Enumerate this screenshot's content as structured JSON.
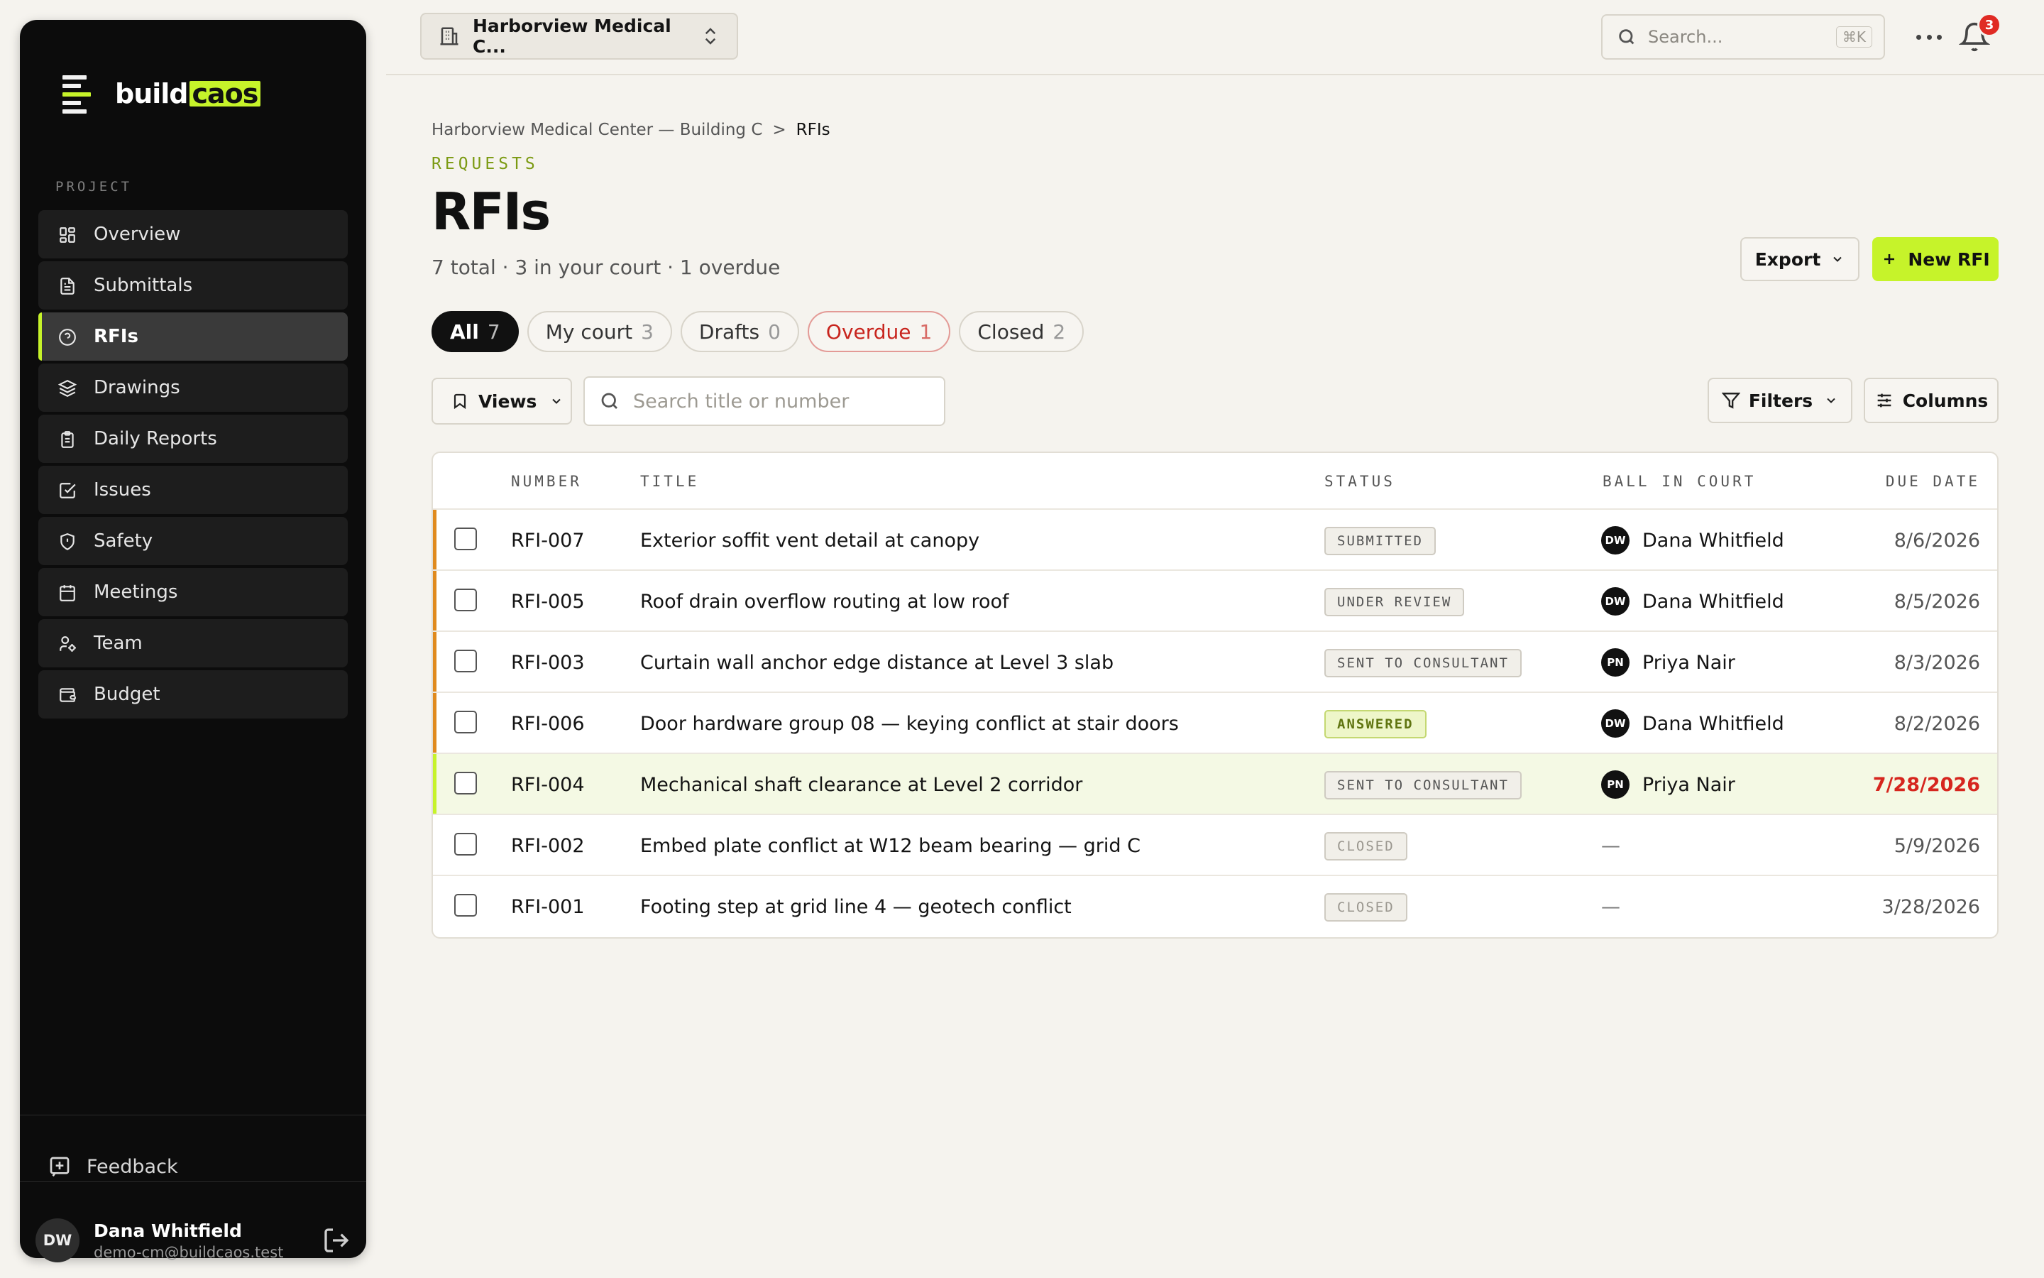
{
  "brand": {
    "name_prefix": "build",
    "name_highlight": "caos"
  },
  "sidebar": {
    "section_label": "PROJECT",
    "items": [
      {
        "label": "Overview",
        "icon": "grid-icon",
        "active": false
      },
      {
        "label": "Submittals",
        "icon": "document-icon",
        "active": false
      },
      {
        "label": "RFIs",
        "icon": "question-circle-icon",
        "active": true
      },
      {
        "label": "Drawings",
        "icon": "layers-icon",
        "active": false
      },
      {
        "label": "Daily Reports",
        "icon": "clipboard-icon",
        "active": false
      },
      {
        "label": "Issues",
        "icon": "check-square-icon",
        "active": false
      },
      {
        "label": "Safety",
        "icon": "shield-icon",
        "active": false
      },
      {
        "label": "Meetings",
        "icon": "calendar-icon",
        "active": false
      },
      {
        "label": "Team",
        "icon": "users-icon",
        "active": false
      },
      {
        "label": "Budget",
        "icon": "wallet-icon",
        "active": false
      }
    ],
    "feedback_label": "Feedback",
    "user": {
      "initials": "DW",
      "name": "Dana Whitfield",
      "email": "demo-cm@buildcaos.test"
    }
  },
  "topbar": {
    "project_name": "Harborview Medical C...",
    "search_placeholder": "Search...",
    "search_shortcut": "⌘K",
    "notification_count": "3"
  },
  "page": {
    "breadcrumb": {
      "parent": "Harborview Medical Center — Building C",
      "separator": ">",
      "current": "RFIs"
    },
    "eyebrow": "REQUESTS",
    "title": "RFIs",
    "subtitle": "7 total · 3 in your court · 1 overdue",
    "export_label": "Export",
    "new_label": "New RFI",
    "tabs": [
      {
        "label": "All",
        "count": "7"
      },
      {
        "label": "My court",
        "count": "3"
      },
      {
        "label": "Drafts",
        "count": "0"
      },
      {
        "label": "Overdue",
        "count": "1"
      },
      {
        "label": "Closed",
        "count": "2"
      }
    ],
    "views_label": "Views",
    "search_placeholder": "Search title or number",
    "filters_label": "Filters",
    "columns_label": "Columns"
  },
  "table": {
    "headers": {
      "number": "NUMBER",
      "title": "TITLE",
      "status": "STATUS",
      "ball": "BALL IN COURT",
      "due": "DUE DATE"
    },
    "rows": [
      {
        "number": "RFI-007",
        "title": "Exterior soffit vent detail at canopy",
        "status": "SUBMITTED",
        "ball_initials": "DW",
        "ball": "Dana Whitfield",
        "due": "8/6/2026"
      },
      {
        "number": "RFI-005",
        "title": "Roof drain overflow routing at low roof",
        "status": "UNDER REVIEW",
        "ball_initials": "DW",
        "ball": "Dana Whitfield",
        "due": "8/5/2026"
      },
      {
        "number": "RFI-003",
        "title": "Curtain wall anchor edge distance at Level 3 slab",
        "status": "SENT TO CONSULTANT",
        "ball_initials": "PN",
        "ball": "Priya Nair",
        "due": "8/3/2026"
      },
      {
        "number": "RFI-006",
        "title": "Door hardware group 08 — keying conflict at stair doors",
        "status": "ANSWERED",
        "ball_initials": "DW",
        "ball": "Dana Whitfield",
        "due": "8/2/2026"
      },
      {
        "number": "RFI-004",
        "title": "Mechanical shaft clearance at Level 2 corridor",
        "status": "SENT TO CONSULTANT",
        "ball_initials": "PN",
        "ball": "Priya Nair",
        "due": "7/28/2026"
      },
      {
        "number": "RFI-002",
        "title": "Embed plate conflict at W12 beam bearing — grid C",
        "status": "CLOSED",
        "ball_initials": "",
        "ball": "—",
        "due": "5/9/2026"
      },
      {
        "number": "RFI-001",
        "title": "Footing step at grid line 4 — geotech conflict",
        "status": "CLOSED",
        "ball_initials": "",
        "ball": "—",
        "due": "3/28/2026"
      }
    ]
  },
  "colors": {
    "accent": "#c6f32a",
    "overdue": "#d6261e",
    "pending_bar": "#e08a1e"
  }
}
